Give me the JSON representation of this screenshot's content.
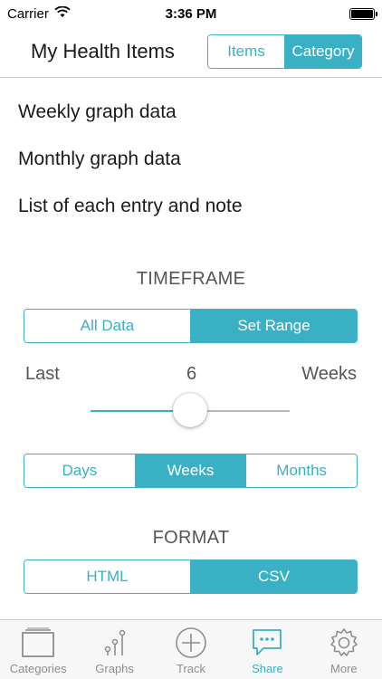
{
  "status_bar": {
    "carrier": "Carrier",
    "time": "3:36 PM"
  },
  "nav": {
    "title": "My Health Items",
    "segments": [
      {
        "label": "Items",
        "active": false
      },
      {
        "label": "Category",
        "active": true
      }
    ]
  },
  "options": [
    "Weekly graph data",
    "Monthly graph data",
    "List of each entry and note"
  ],
  "timeframe": {
    "heading": "TIMEFRAME",
    "range_segments": [
      {
        "label": "All Data",
        "active": false
      },
      {
        "label": "Set Range",
        "active": true
      }
    ],
    "last_label": "Last",
    "value": "6",
    "unit_label": "Weeks",
    "slider_fraction": 0.5,
    "unit_segments": [
      {
        "label": "Days",
        "active": false
      },
      {
        "label": "Weeks",
        "active": true
      },
      {
        "label": "Months",
        "active": false
      }
    ]
  },
  "format": {
    "heading": "FORMAT",
    "segments": [
      {
        "label": "HTML",
        "active": false
      },
      {
        "label": "CSV",
        "active": true
      }
    ]
  },
  "tab_bar": {
    "items": [
      {
        "label": "Categories",
        "icon": "categories-icon",
        "active": false
      },
      {
        "label": "Graphs",
        "icon": "graphs-icon",
        "active": false
      },
      {
        "label": "Track",
        "icon": "track-plus-icon",
        "active": false
      },
      {
        "label": "Share",
        "icon": "share-chat-icon",
        "active": true
      },
      {
        "label": "More",
        "icon": "gear-icon",
        "active": false
      }
    ]
  },
  "colors": {
    "accent": "#3ab0c4",
    "tab_inactive": "#8e8e8e",
    "text": "#1a1a1a"
  }
}
